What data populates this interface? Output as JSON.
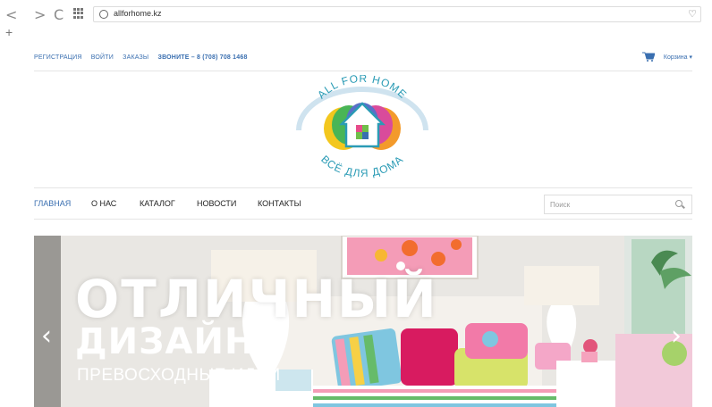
{
  "browser": {
    "url": "allforhome.kz",
    "back_icon": "back-icon",
    "forward_icon": "forward-icon",
    "reload_icon": "reload-icon",
    "new_tab_label": "+"
  },
  "topbar": {
    "links": [
      "РЕГИСТРАЦИЯ",
      "ВОЙТИ",
      "ЗАКАЗЫ",
      "ЗВОНИТЕ – 8 (708) 708 1468"
    ],
    "cart_label": "Корзина ▾"
  },
  "logo": {
    "top_text": "ALL FOR HOME",
    "bottom_text": "ВСЁ ДЛЯ ДОМА"
  },
  "nav": {
    "items": [
      "ГЛАВНАЯ",
      "О НАС",
      "КАТАЛОГ",
      "НОВОСТИ",
      "КОНТАКТЫ"
    ],
    "search_placeholder": "Поиск"
  },
  "hero": {
    "title_line1": "ОТЛИЧНЫЙ",
    "title_line2": "ДИЗАЙН",
    "subtitle": "ПРЕВОСХОДНЫЕ ИДЕИ",
    "prev_arrow": "‹",
    "next_arrow": "›"
  },
  "colors": {
    "link_blue": "#3a6fb0",
    "logo_teal": "#2a9bb5"
  }
}
